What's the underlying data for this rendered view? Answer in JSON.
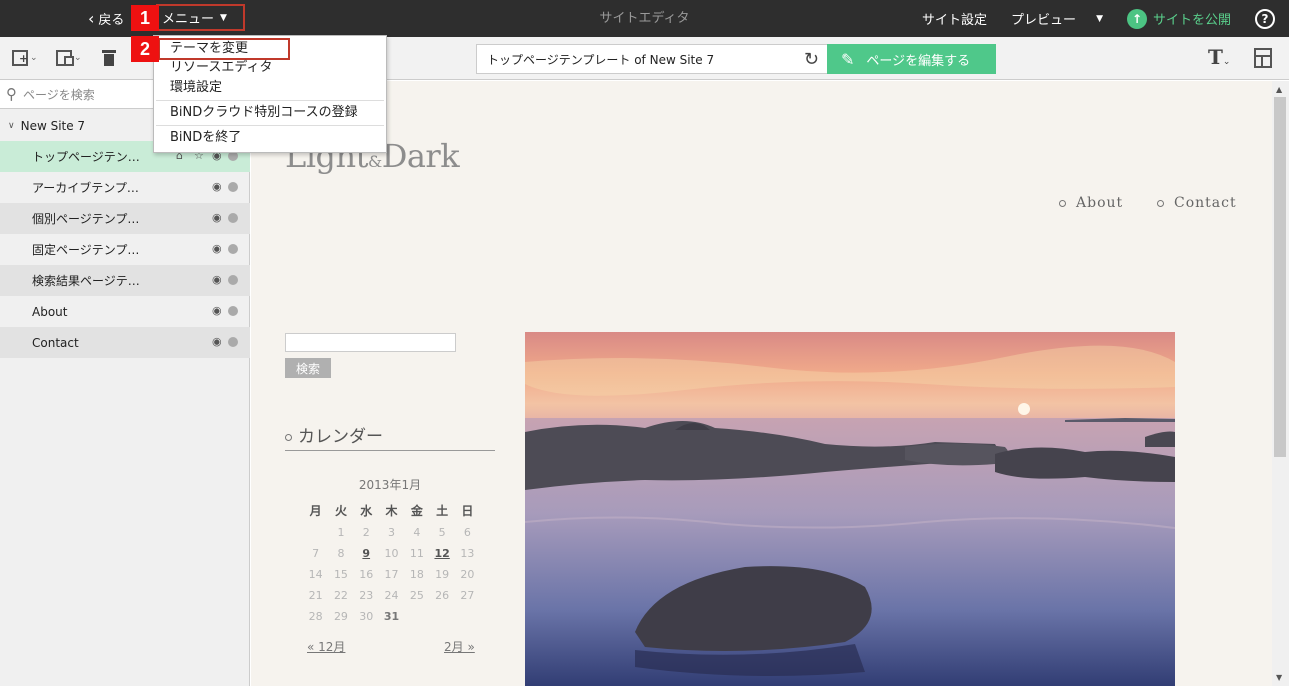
{
  "app": {
    "title": "サイトエディタ"
  },
  "topbar": {
    "back_label": "戻る",
    "menu_label": "メニュー",
    "site_settings": "サイト設定",
    "preview": "プレビュー",
    "publish": "サイトを公開"
  },
  "menu": {
    "items": [
      {
        "label": "テーマを変更"
      },
      {
        "label": "リソースエディタ"
      },
      {
        "label": "環境設定"
      },
      {
        "label": "BiNDクラウド特別コースの登録"
      },
      {
        "label": "BiNDを終了"
      }
    ]
  },
  "annotations": {
    "step1": "1",
    "step2": "2"
  },
  "toolbar": {
    "address": "トップページテンプレート of New Site 7",
    "edit_button": "ページを編集する"
  },
  "sidebar": {
    "search_placeholder": "ページを検索",
    "site_name": "New Site 7",
    "pages": [
      {
        "label": "トップページテン…"
      },
      {
        "label": "アーカイブテンプ…"
      },
      {
        "label": "個別ページテンプ…"
      },
      {
        "label": "固定ページテンプ…"
      },
      {
        "label": "検索結果ページテ…"
      },
      {
        "label": "About"
      },
      {
        "label": "Contact"
      }
    ]
  },
  "preview": {
    "logo_left": "Light",
    "logo_amp": "&",
    "logo_right": "Dark",
    "nav": [
      "About",
      "Contact"
    ],
    "search_button": "検索",
    "calendar_heading": "カレンダー",
    "calendar_month": "2013年1月",
    "weekdays": [
      "月",
      "火",
      "水",
      "木",
      "金",
      "土",
      "日"
    ],
    "days": [
      "1",
      "2",
      "3",
      "4",
      "5",
      "6",
      "7",
      "8",
      "9",
      "10",
      "11",
      "12",
      "13",
      "14",
      "15",
      "16",
      "17",
      "18",
      "19",
      "20",
      "21",
      "22",
      "23",
      "24",
      "25",
      "26",
      "27",
      "28",
      "29",
      "30",
      "31"
    ],
    "prev_link": "« 12月",
    "next_link": "2月 »"
  },
  "colors": {
    "topbar": "#2e2e2e",
    "accent_green": "#4fc88a",
    "highlight_red": "#c0392b",
    "badge_red": "#ee1111",
    "canvas": "#f6f3ee"
  }
}
